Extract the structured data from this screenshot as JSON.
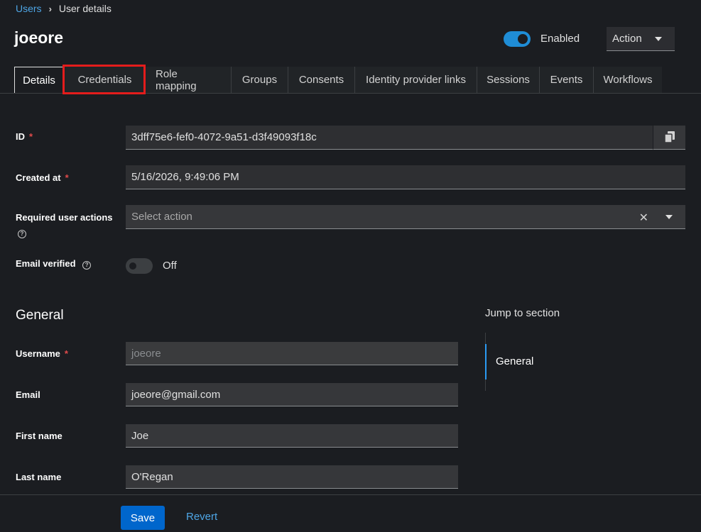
{
  "breadcrumb": {
    "parent": "Users",
    "current": "User details"
  },
  "header": {
    "title": "joeore",
    "enabled_label": "Enabled",
    "enabled": true,
    "action_label": "Action"
  },
  "tabs": [
    {
      "label": "Details",
      "active": true
    },
    {
      "label": "Credentials",
      "active": false
    },
    {
      "label": "Role mapping",
      "active": false
    },
    {
      "label": "Groups",
      "active": false
    },
    {
      "label": "Consents",
      "active": false
    },
    {
      "label": "Identity provider links",
      "active": false
    },
    {
      "label": "Sessions",
      "active": false
    },
    {
      "label": "Events",
      "active": false
    },
    {
      "label": "Workflows",
      "active": false
    }
  ],
  "form": {
    "id": {
      "label": "ID",
      "value": "3dff75e6-fef0-4072-9a51-d3f49093f18c",
      "required": "*"
    },
    "created_at": {
      "label": "Created at",
      "value": "5/16/2026, 9:49:06 PM",
      "required": "*"
    },
    "required_actions": {
      "label": "Required user actions",
      "placeholder": "Select action"
    },
    "email_verified": {
      "label": "Email verified",
      "state_label": "Off",
      "enabled": false
    }
  },
  "general": {
    "title": "General",
    "username": {
      "label": "Username",
      "value": "joeore",
      "required": "*"
    },
    "email": {
      "label": "Email",
      "value": "joeore@gmail.com"
    },
    "first_name": {
      "label": "First name",
      "value": "Joe"
    },
    "last_name": {
      "label": "Last name",
      "value": "O'Regan"
    }
  },
  "jump": {
    "title": "Jump to section",
    "items": [
      "General"
    ]
  },
  "footer": {
    "save_label": "Save",
    "revert_label": "Revert"
  },
  "colors": {
    "accent": "#0066cc",
    "link": "#4ea6e6",
    "toggle_on": "#1f8dd6",
    "highlight": "#e41c1c",
    "required": "#e04b4b"
  }
}
